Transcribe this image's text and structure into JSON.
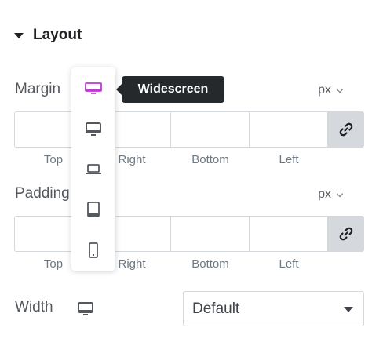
{
  "section": {
    "title": "Layout",
    "icon": "caret-down-icon"
  },
  "margin": {
    "label": "Margin",
    "unit": "px",
    "values": {
      "top": "",
      "right": "",
      "bottom": "",
      "left": ""
    },
    "sides": [
      "Top",
      "Right",
      "Bottom",
      "Left"
    ]
  },
  "padding": {
    "label": "Padding",
    "unit": "px",
    "values": {
      "top": "",
      "right": "",
      "bottom": "",
      "left": ""
    },
    "sides": [
      "Top",
      "Right",
      "Bottom",
      "Left"
    ]
  },
  "width": {
    "label": "Width",
    "selected": "Default"
  },
  "device_menu": {
    "items": [
      "widescreen",
      "desktop",
      "laptop",
      "tablet",
      "mobile"
    ],
    "active": "widescreen",
    "tooltip": "Widescreen"
  },
  "colors": {
    "active": "#c036d6",
    "icon": "#55595e",
    "tooltip_bg": "#26292c",
    "link_bg": "#d5d8dc"
  }
}
